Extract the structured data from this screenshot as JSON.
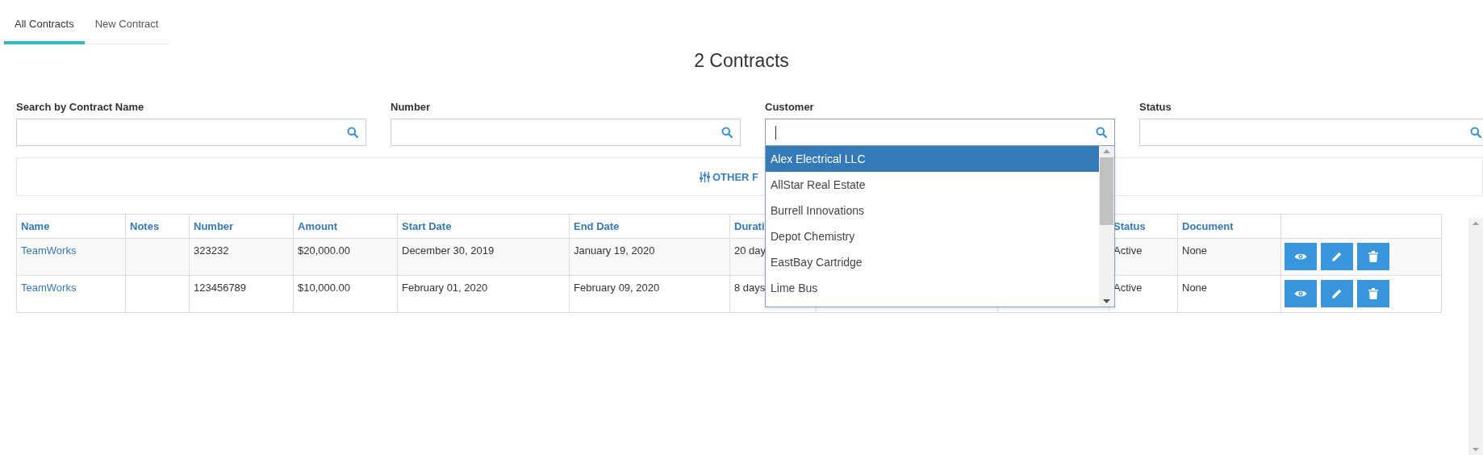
{
  "tabs": [
    {
      "label": "All Contracts",
      "selected": true
    },
    {
      "label": "New Contract",
      "selected": false
    }
  ],
  "heading": "2 Contracts",
  "filters": [
    {
      "label": "Search by Contract Name",
      "focused": false
    },
    {
      "label": "Number",
      "focused": false
    },
    {
      "label": "Customer",
      "focused": true
    },
    {
      "label": "Status",
      "focused": false
    }
  ],
  "other_filters": {
    "label": "OTHER F"
  },
  "customer_dropdown": {
    "options": [
      {
        "label": "Alex Electrical LLC",
        "selected": true
      },
      {
        "label": "AllStar Real Estate",
        "selected": false
      },
      {
        "label": "Burrell Innovations",
        "selected": false
      },
      {
        "label": "Depot Chemistry",
        "selected": false
      },
      {
        "label": "EastBay Cartridge",
        "selected": false
      },
      {
        "label": "Lime Bus",
        "selected": false
      }
    ]
  },
  "table": {
    "columns": [
      "Name",
      "Notes",
      "Number",
      "Amount",
      "Start Date",
      "End Date",
      "Durati",
      "Status",
      "Document"
    ],
    "rows": [
      {
        "name": "TeamWorks",
        "number": "323232",
        "amount": "$20,000.00",
        "start_date": "December 30, 2019",
        "end_date": "January 19, 2020",
        "duration": "20 day",
        "status": "Active",
        "document": "None"
      },
      {
        "name": "TeamWorks",
        "number": "123456789",
        "amount": "$10,000.00",
        "start_date": "February 01, 2020",
        "end_date": "February 09, 2020",
        "duration": "8 days",
        "status": "Active",
        "document": "None"
      }
    ]
  }
}
